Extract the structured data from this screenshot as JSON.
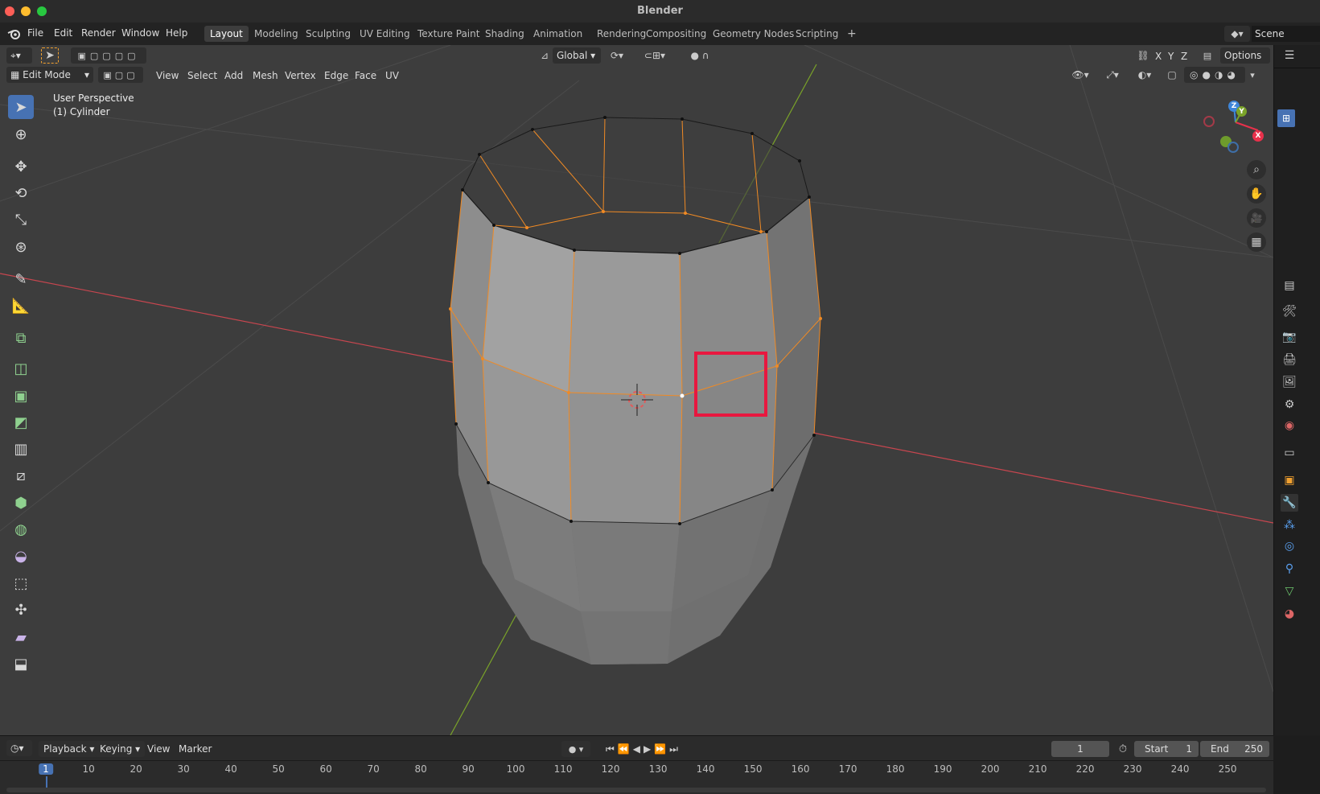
{
  "window": {
    "title": "Blender"
  },
  "menubar": {
    "items": [
      "File",
      "Edit",
      "Render",
      "Window",
      "Help"
    ]
  },
  "workspaces": {
    "tabs": [
      "Layout",
      "Modeling",
      "Sculpting",
      "UV Editing",
      "Texture Paint",
      "Shading",
      "Animation",
      "Rendering",
      "Compositing",
      "Geometry Nodes",
      "Scripting"
    ],
    "active": "Layout",
    "add": "+"
  },
  "scene": {
    "name": "Scene"
  },
  "viewport_header": {
    "transform_orientation": "Global",
    "axes": [
      "X",
      "Y",
      "Z"
    ],
    "options": "Options",
    "mode": "Edit Mode",
    "menus": [
      "View",
      "Select",
      "Add",
      "Mesh",
      "Vertex",
      "Edge",
      "Face",
      "UV"
    ]
  },
  "overlay_text": {
    "perspective": "User Perspective",
    "object": "(1) Cylinder"
  },
  "gizmo": {
    "x": "X",
    "y": "Y",
    "z": "Z"
  },
  "timeline": {
    "menus": [
      "Playback",
      "Keying",
      "View",
      "Marker"
    ],
    "current_frame": "1",
    "start_label": "Start",
    "start": "1",
    "end_label": "End",
    "end": "250",
    "ruler": [
      "1",
      "10",
      "20",
      "30",
      "40",
      "50",
      "60",
      "70",
      "80",
      "90",
      "100",
      "110",
      "120",
      "130",
      "140",
      "150",
      "160",
      "170",
      "180",
      "190",
      "200",
      "210",
      "220",
      "230",
      "240",
      "250"
    ]
  },
  "colors": {
    "accent": "#4772b3",
    "highlight": "#e8173f",
    "selected_edge": "#f08a24",
    "x_axis": "#c8464f",
    "y_axis": "#7aa329"
  }
}
